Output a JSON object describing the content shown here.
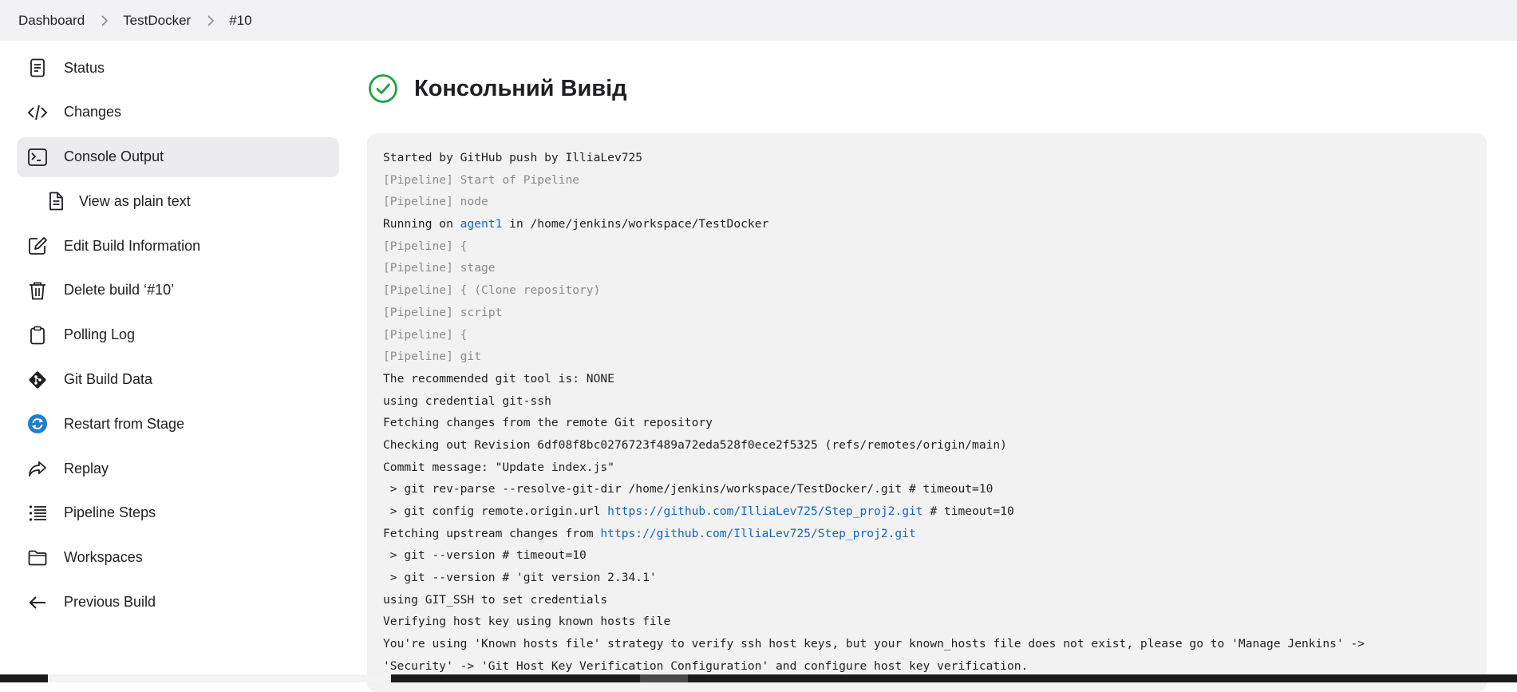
{
  "breadcrumb": [
    "Dashboard",
    "TestDocker",
    "#10"
  ],
  "sidebar": {
    "items": [
      {
        "label": "Status",
        "icon": "document-icon"
      },
      {
        "label": "Changes",
        "icon": "code-icon"
      },
      {
        "label": "Console Output",
        "icon": "terminal-icon",
        "active": true
      },
      {
        "label": "View as plain text",
        "icon": "file-icon",
        "sub": true
      },
      {
        "label": "Edit Build Information",
        "icon": "edit-icon"
      },
      {
        "label": "Delete build ‘#10’",
        "icon": "trash-icon"
      },
      {
        "label": "Polling Log",
        "icon": "clipboard-icon"
      },
      {
        "label": "Git Build Data",
        "icon": "git-icon"
      },
      {
        "label": "Restart from Stage",
        "icon": "restart-icon"
      },
      {
        "label": "Replay",
        "icon": "replay-icon"
      },
      {
        "label": "Pipeline Steps",
        "icon": "steps-icon"
      },
      {
        "label": "Workspaces",
        "icon": "folder-icon"
      },
      {
        "label": "Previous Build",
        "icon": "arrow-left-icon"
      }
    ]
  },
  "header": {
    "title": "Консольний Вивід",
    "status_icon": "success-check-icon",
    "status_color": "#1ea446"
  },
  "console": {
    "link_color": "#1565c0",
    "lines": [
      {
        "text": "Started by GitHub push by IlliaLev725"
      },
      {
        "text": "[Pipeline] Start of Pipeline",
        "muted": true
      },
      {
        "text": "[Pipeline] node",
        "muted": true
      },
      {
        "parts": [
          {
            "t": "Running on "
          },
          {
            "t": "agent1",
            "link": true
          },
          {
            "t": " in /home/jenkins/workspace/TestDocker"
          }
        ]
      },
      {
        "text": "[Pipeline] {",
        "muted": true
      },
      {
        "text": "[Pipeline] stage",
        "muted": true
      },
      {
        "text": "[Pipeline] { (Clone repository)",
        "muted": true
      },
      {
        "text": "[Pipeline] script",
        "muted": true
      },
      {
        "text": "[Pipeline] {",
        "muted": true
      },
      {
        "text": "[Pipeline] git",
        "muted": true
      },
      {
        "text": "The recommended git tool is: NONE"
      },
      {
        "text": "using credential git-ssh"
      },
      {
        "text": "Fetching changes from the remote Git repository"
      },
      {
        "text": "Checking out Revision 6df08f8bc0276723f489a72eda528f0ece2f5325 (refs/remotes/origin/main)"
      },
      {
        "text": "Commit message: \"Update index.js\""
      },
      {
        "text": " > git rev-parse --resolve-git-dir /home/jenkins/workspace/TestDocker/.git # timeout=10"
      },
      {
        "parts": [
          {
            "t": " > git config remote.origin.url "
          },
          {
            "t": "https://github.com/IlliaLev725/Step_proj2.git",
            "link": true
          },
          {
            "t": " # timeout=10"
          }
        ]
      },
      {
        "parts": [
          {
            "t": "Fetching upstream changes from "
          },
          {
            "t": "https://github.com/IlliaLev725/Step_proj2.git",
            "link": true
          }
        ]
      },
      {
        "text": " > git --version # timeout=10"
      },
      {
        "text": " > git --version # 'git version 2.34.1'"
      },
      {
        "text": "using GIT_SSH to set credentials"
      },
      {
        "text": "Verifying host key using known hosts file"
      },
      {
        "text": "You're using 'Known hosts file' strategy to verify ssh host keys, but your known_hosts file does not exist, please go to 'Manage Jenkins' ->"
      },
      {
        "text": "'Security' -> 'Git Host Key Verification Configuration' and configure host key verification."
      }
    ]
  }
}
